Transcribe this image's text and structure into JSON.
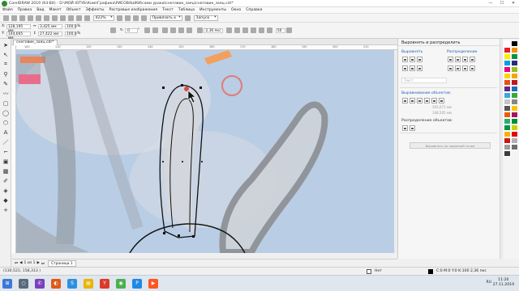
{
  "titlebar": {
    "title": "CorelDRAW 2019 (64-Bit) - D:\\МОЙ ЮТУБ\\КомпГрафика\\РИСОВАШКИ\\сами уроки\\снеговик_заяц\\снеговик_заяц.cdr*",
    "minimize": "—",
    "maximize": "☐",
    "close": "✕"
  },
  "menu": [
    "Файл",
    "Правка",
    "Вид",
    "Макет",
    "Объект",
    "Эффекты",
    "Растровые изображения",
    "Текст",
    "Таблица",
    "Инструменты",
    "Окно",
    "Справка"
  ],
  "stdbar": {
    "zoom": "422%",
    "snap": "Привязать к",
    "launch": "Запуск"
  },
  "propbar": {
    "x": "128,195 мм",
    "y": "144,665 мм",
    "w": "3,425 мм",
    "h": "27,422 мм",
    "sx": "100,0",
    "sy": "100,0",
    "pct": "%",
    "rotation": ".0",
    "rot_unit": "°",
    "outline": "2,36 пкс",
    "spin": "50"
  },
  "doc_tab": "снеговик_заяц.cdr*",
  "ruler_h": [
    "100",
    "110",
    "120",
    "130",
    "140",
    "150",
    "160",
    "170",
    "180",
    "190",
    "200",
    "210"
  ],
  "docker": {
    "title": "Выровнять и распределить",
    "align_label": "Выровнять",
    "distribute_label": "Распределение",
    "text_placeholder": "Текст",
    "align_objects_to": "Выравнивание объектов:",
    "coord1": "105,071 мм",
    "coord2": "148,505 мм",
    "distribute_to": "Распределение объектов:",
    "button": "Выровнять по заданной точке"
  },
  "page_tab": "Страница 1",
  "page_counter": "1 из 1",
  "status": {
    "coords": "(130,521; 158,313 )",
    "fill_none": "Нет",
    "outline_info": "C:0 M:0 Y:0 K:100  2,36 пкс"
  },
  "taskbar": {
    "lang": "RU",
    "time": "11:20",
    "date": "27.11.2019"
  },
  "colors": {
    "canvas_bg": "#b7cbe2",
    "selection_red": "#d84a4a",
    "accent": "#1a5fb4"
  },
  "palette": [
    "#ffffff",
    "#000000",
    "#e31e24",
    "#f39200",
    "#ffed00",
    "#009640",
    "#00a0e3",
    "#312783",
    "#e6007e",
    "#95c11f",
    "#ffd200",
    "#f7a600",
    "#e94e1b",
    "#be1622",
    "#662483",
    "#1d71b8",
    "#36a9e1",
    "#3aaa35",
    "#c6c6c6",
    "#878787",
    "#575756",
    "#fdc300",
    "#ea5b0c",
    "#a3195b",
    "#2fac66",
    "#008d36",
    "#00963f",
    "#c8d400",
    "#f9b000",
    "#e30613",
    "#cd1719",
    "#b2b2b2",
    "#9d9d9c",
    "#706f6f",
    "#3c3c3b"
  ]
}
